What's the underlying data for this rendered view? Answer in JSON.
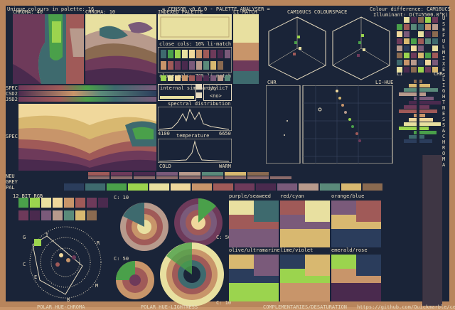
{
  "header": {
    "unique_colours": "Unique colours in palette: 16",
    "app_title": "= CENSOR v0.6.0 - PALETTE ANALYSER =",
    "colour_difference": "Colour difference: CAM16UCS",
    "illuminant": "Illuminant: D(T=5500.0°K)"
  },
  "panels": {
    "chroma40": "CHROMA: 40",
    "chroma10": "CHROMA: 10",
    "indexed_palette": "INDEXED PALETTE",
    "li_match": "LI-MATCH",
    "cam16ucs": "CAM16UCS COLOURSPACE",
    "useful_mixes": "USEFUL MIXES",
    "lightness_chroma": "LIGHTNESS & CHROMA",
    "spec": "SPEC",
    "csd2": "CSD2",
    "j5d2": "J5D2",
    "spec_bgn": "SPEC BGN",
    "neu": "NEU",
    "grey": "GREY",
    "pal": "PAL",
    "bit_rgb": "12 BIT RGB",
    "chr_left": "CHR",
    "li_hue": "LI-HUE",
    "li": "LI",
    "chr_right": "CHR",
    "polar_hue_chroma": "POLAR HUE-CHROMA",
    "polar_hue_lightness": "POLAR HUE-LIGHTNESS",
    "complementaries": "COMPLEMENTARIES/DESATURATION",
    "github": "https://github.com/Quickmarble/censor"
  },
  "controls": {
    "close_10": "close cols: 10% li-match",
    "close_70": "close cols: 70% li-match",
    "internal_similarity": "internal similarity",
    "cyclic": "cyclic?",
    "cyclic_value": "<no>",
    "spectral_distribution": "spectral distribution",
    "spec_min": "4100",
    "spec_max": "6650",
    "temperature": "temperature",
    "cold": "COLD",
    "warm": "WARM"
  },
  "polar": {
    "c10a": "C: 10",
    "c50a": "C: 50",
    "c50b": "C: 50",
    "c10b": "C: 10"
  },
  "hue_chroma_marks": [
    "G",
    "Y",
    "R",
    "C",
    "B",
    "M",
    "E"
  ],
  "comp_labels": [
    "purple/seaweed",
    "red/cyan",
    "orange/blue",
    "olive/ultramarine",
    "lime/violet",
    "emerald/rose"
  ],
  "palette": [
    "#1a2438",
    "#2b3d5c",
    "#3e6a6e",
    "#4aa04a",
    "#9bd44e",
    "#e8e0a0",
    "#f0d89c",
    "#c8956a",
    "#a05a58",
    "#6e3a5a",
    "#4a2a4e",
    "#7a5a7a",
    "#b89a8c",
    "#5a8a7a",
    "#d8b870",
    "#8a6a50"
  ]
}
